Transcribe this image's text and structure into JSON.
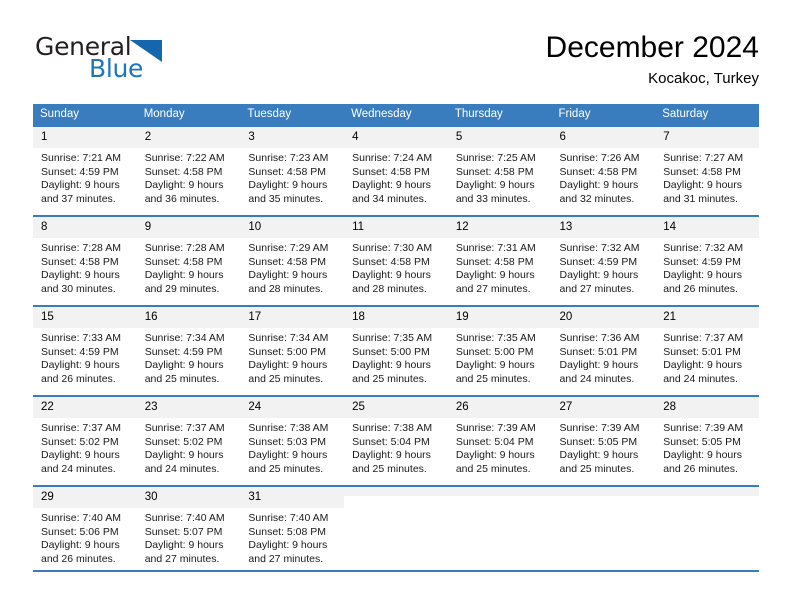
{
  "brand": {
    "word_one": "General",
    "word_two": "Blue",
    "icon": "triangle-logo-icon",
    "color_dark": "#231f20",
    "color_blue": "#1d76bb"
  },
  "header": {
    "month_title": "December 2024",
    "location": "Kocakoc, Turkey"
  },
  "theme": {
    "header_blue": "#3a7dbf",
    "daynum_bg": "#f2f2f2",
    "text": "#000000"
  },
  "calendar": {
    "weekday_headers": [
      "Sunday",
      "Monday",
      "Tuesday",
      "Wednesday",
      "Thursday",
      "Friday",
      "Saturday"
    ],
    "weeks": [
      [
        {
          "day": "1",
          "sunrise": "Sunrise: 7:21 AM",
          "sunset": "Sunset: 4:59 PM",
          "daylight_line1": "Daylight: 9 hours",
          "daylight_line2": "and 37 minutes."
        },
        {
          "day": "2",
          "sunrise": "Sunrise: 7:22 AM",
          "sunset": "Sunset: 4:58 PM",
          "daylight_line1": "Daylight: 9 hours",
          "daylight_line2": "and 36 minutes."
        },
        {
          "day": "3",
          "sunrise": "Sunrise: 7:23 AM",
          "sunset": "Sunset: 4:58 PM",
          "daylight_line1": "Daylight: 9 hours",
          "daylight_line2": "and 35 minutes."
        },
        {
          "day": "4",
          "sunrise": "Sunrise: 7:24 AM",
          "sunset": "Sunset: 4:58 PM",
          "daylight_line1": "Daylight: 9 hours",
          "daylight_line2": "and 34 minutes."
        },
        {
          "day": "5",
          "sunrise": "Sunrise: 7:25 AM",
          "sunset": "Sunset: 4:58 PM",
          "daylight_line1": "Daylight: 9 hours",
          "daylight_line2": "and 33 minutes."
        },
        {
          "day": "6",
          "sunrise": "Sunrise: 7:26 AM",
          "sunset": "Sunset: 4:58 PM",
          "daylight_line1": "Daylight: 9 hours",
          "daylight_line2": "and 32 minutes."
        },
        {
          "day": "7",
          "sunrise": "Sunrise: 7:27 AM",
          "sunset": "Sunset: 4:58 PM",
          "daylight_line1": "Daylight: 9 hours",
          "daylight_line2": "and 31 minutes."
        }
      ],
      [
        {
          "day": "8",
          "sunrise": "Sunrise: 7:28 AM",
          "sunset": "Sunset: 4:58 PM",
          "daylight_line1": "Daylight: 9 hours",
          "daylight_line2": "and 30 minutes."
        },
        {
          "day": "9",
          "sunrise": "Sunrise: 7:28 AM",
          "sunset": "Sunset: 4:58 PM",
          "daylight_line1": "Daylight: 9 hours",
          "daylight_line2": "and 29 minutes."
        },
        {
          "day": "10",
          "sunrise": "Sunrise: 7:29 AM",
          "sunset": "Sunset: 4:58 PM",
          "daylight_line1": "Daylight: 9 hours",
          "daylight_line2": "and 28 minutes."
        },
        {
          "day": "11",
          "sunrise": "Sunrise: 7:30 AM",
          "sunset": "Sunset: 4:58 PM",
          "daylight_line1": "Daylight: 9 hours",
          "daylight_line2": "and 28 minutes."
        },
        {
          "day": "12",
          "sunrise": "Sunrise: 7:31 AM",
          "sunset": "Sunset: 4:58 PM",
          "daylight_line1": "Daylight: 9 hours",
          "daylight_line2": "and 27 minutes."
        },
        {
          "day": "13",
          "sunrise": "Sunrise: 7:32 AM",
          "sunset": "Sunset: 4:59 PM",
          "daylight_line1": "Daylight: 9 hours",
          "daylight_line2": "and 27 minutes."
        },
        {
          "day": "14",
          "sunrise": "Sunrise: 7:32 AM",
          "sunset": "Sunset: 4:59 PM",
          "daylight_line1": "Daylight: 9 hours",
          "daylight_line2": "and 26 minutes."
        }
      ],
      [
        {
          "day": "15",
          "sunrise": "Sunrise: 7:33 AM",
          "sunset": "Sunset: 4:59 PM",
          "daylight_line1": "Daylight: 9 hours",
          "daylight_line2": "and 26 minutes."
        },
        {
          "day": "16",
          "sunrise": "Sunrise: 7:34 AM",
          "sunset": "Sunset: 4:59 PM",
          "daylight_line1": "Daylight: 9 hours",
          "daylight_line2": "and 25 minutes."
        },
        {
          "day": "17",
          "sunrise": "Sunrise: 7:34 AM",
          "sunset": "Sunset: 5:00 PM",
          "daylight_line1": "Daylight: 9 hours",
          "daylight_line2": "and 25 minutes."
        },
        {
          "day": "18",
          "sunrise": "Sunrise: 7:35 AM",
          "sunset": "Sunset: 5:00 PM",
          "daylight_line1": "Daylight: 9 hours",
          "daylight_line2": "and 25 minutes."
        },
        {
          "day": "19",
          "sunrise": "Sunrise: 7:35 AM",
          "sunset": "Sunset: 5:00 PM",
          "daylight_line1": "Daylight: 9 hours",
          "daylight_line2": "and 25 minutes."
        },
        {
          "day": "20",
          "sunrise": "Sunrise: 7:36 AM",
          "sunset": "Sunset: 5:01 PM",
          "daylight_line1": "Daylight: 9 hours",
          "daylight_line2": "and 24 minutes."
        },
        {
          "day": "21",
          "sunrise": "Sunrise: 7:37 AM",
          "sunset": "Sunset: 5:01 PM",
          "daylight_line1": "Daylight: 9 hours",
          "daylight_line2": "and 24 minutes."
        }
      ],
      [
        {
          "day": "22",
          "sunrise": "Sunrise: 7:37 AM",
          "sunset": "Sunset: 5:02 PM",
          "daylight_line1": "Daylight: 9 hours",
          "daylight_line2": "and 24 minutes."
        },
        {
          "day": "23",
          "sunrise": "Sunrise: 7:37 AM",
          "sunset": "Sunset: 5:02 PM",
          "daylight_line1": "Daylight: 9 hours",
          "daylight_line2": "and 24 minutes."
        },
        {
          "day": "24",
          "sunrise": "Sunrise: 7:38 AM",
          "sunset": "Sunset: 5:03 PM",
          "daylight_line1": "Daylight: 9 hours",
          "daylight_line2": "and 25 minutes."
        },
        {
          "day": "25",
          "sunrise": "Sunrise: 7:38 AM",
          "sunset": "Sunset: 5:04 PM",
          "daylight_line1": "Daylight: 9 hours",
          "daylight_line2": "and 25 minutes."
        },
        {
          "day": "26",
          "sunrise": "Sunrise: 7:39 AM",
          "sunset": "Sunset: 5:04 PM",
          "daylight_line1": "Daylight: 9 hours",
          "daylight_line2": "and 25 minutes."
        },
        {
          "day": "27",
          "sunrise": "Sunrise: 7:39 AM",
          "sunset": "Sunset: 5:05 PM",
          "daylight_line1": "Daylight: 9 hours",
          "daylight_line2": "and 25 minutes."
        },
        {
          "day": "28",
          "sunrise": "Sunrise: 7:39 AM",
          "sunset": "Sunset: 5:05 PM",
          "daylight_line1": "Daylight: 9 hours",
          "daylight_line2": "and 26 minutes."
        }
      ],
      [
        {
          "day": "29",
          "sunrise": "Sunrise: 7:40 AM",
          "sunset": "Sunset: 5:06 PM",
          "daylight_line1": "Daylight: 9 hours",
          "daylight_line2": "and 26 minutes."
        },
        {
          "day": "30",
          "sunrise": "Sunrise: 7:40 AM",
          "sunset": "Sunset: 5:07 PM",
          "daylight_line1": "Daylight: 9 hours",
          "daylight_line2": "and 27 minutes."
        },
        {
          "day": "31",
          "sunrise": "Sunrise: 7:40 AM",
          "sunset": "Sunset: 5:08 PM",
          "daylight_line1": "Daylight: 9 hours",
          "daylight_line2": "and 27 minutes."
        },
        {
          "day": "",
          "sunrise": "",
          "sunset": "",
          "daylight_line1": "",
          "daylight_line2": ""
        },
        {
          "day": "",
          "sunrise": "",
          "sunset": "",
          "daylight_line1": "",
          "daylight_line2": ""
        },
        {
          "day": "",
          "sunrise": "",
          "sunset": "",
          "daylight_line1": "",
          "daylight_line2": ""
        },
        {
          "day": "",
          "sunrise": "",
          "sunset": "",
          "daylight_line1": "",
          "daylight_line2": ""
        }
      ]
    ]
  }
}
